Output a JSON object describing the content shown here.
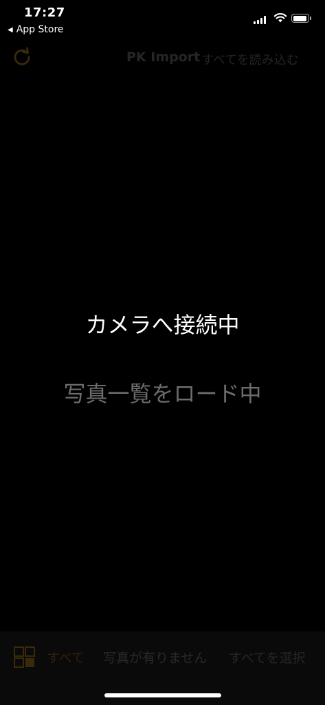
{
  "status_bar": {
    "time": "17:27",
    "back_app": "App Store"
  },
  "nav": {
    "title": "PK Import",
    "action": "すべてを読み込む",
    "refresh_icon": "refresh-icon"
  },
  "main": {
    "status": "カメラへ接続中",
    "substatus": "写真一覧をロード中"
  },
  "toolbar": {
    "grid_icon": "grid-icon",
    "all": "すべて",
    "no_photos": "写真が有りません",
    "select_all": "すべてを選択"
  },
  "colors": {
    "accent": "#3a2a0c",
    "background": "#000000"
  }
}
